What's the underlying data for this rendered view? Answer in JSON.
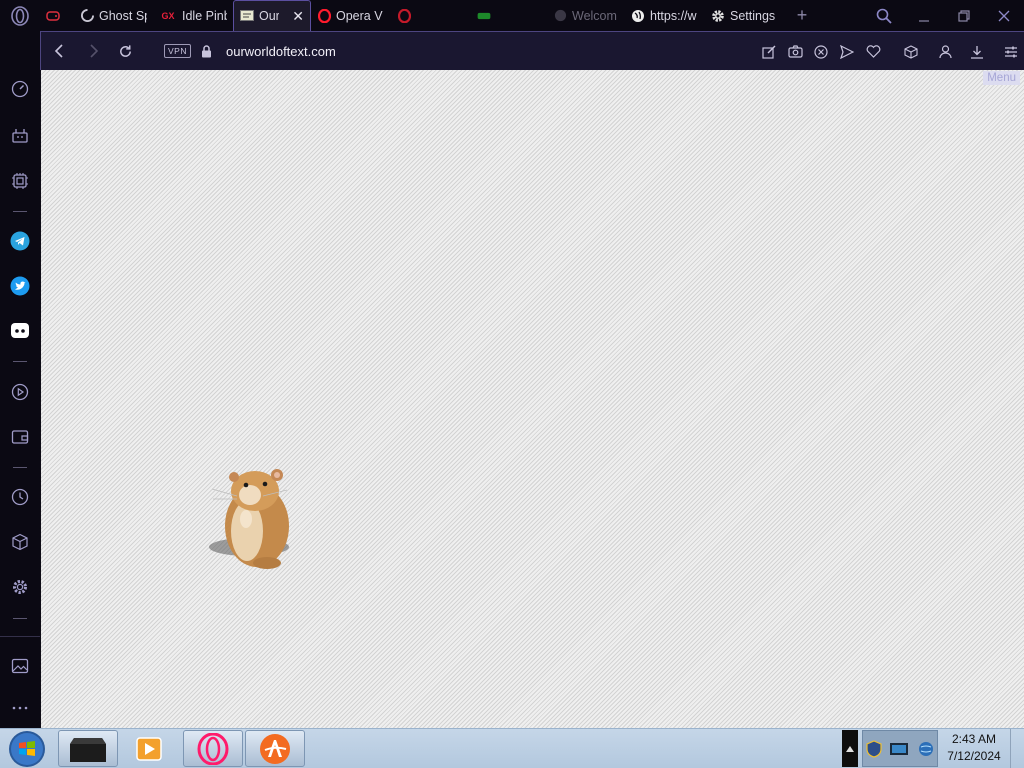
{
  "tabs": [
    {
      "title": "",
      "icon": "gamepad-icon",
      "state": "normal"
    },
    {
      "title": "Ghost Sp",
      "icon": "ghost-spinner-icon",
      "state": "normal"
    },
    {
      "title": "Idle Pinb",
      "icon": "gx-icon",
      "state": "normal"
    },
    {
      "title": "Our \\",
      "icon": "owot-favicon-icon",
      "state": "active"
    },
    {
      "title": "Opera V",
      "icon": "opera-icon",
      "state": "normal"
    },
    {
      "title": "",
      "icon": "opera-icon",
      "state": "faded"
    },
    {
      "title": "",
      "icon": "green-app-icon",
      "state": "faded"
    },
    {
      "title": "Welcom",
      "icon": "globe-icon",
      "state": "faded"
    },
    {
      "title": "https://w",
      "icon": "globe-icon",
      "state": "normal"
    },
    {
      "title": "Settings",
      "icon": "gear-icon",
      "state": "normal"
    }
  ],
  "address": {
    "vpn_label": "VPN",
    "url": "ourworldoftext.com"
  },
  "page": {
    "menu_label": "Menu"
  },
  "taskbar": {
    "time": "2:43 AM",
    "date": "7/12/2024"
  },
  "colors": {
    "accent": "#5b4fa0",
    "tab_bg": "#0b0913",
    "addr_bg": "#1a1730",
    "telegram": "#2aa3df",
    "twitter": "#1d9bf0",
    "opera_red": "#ff1b2d"
  }
}
